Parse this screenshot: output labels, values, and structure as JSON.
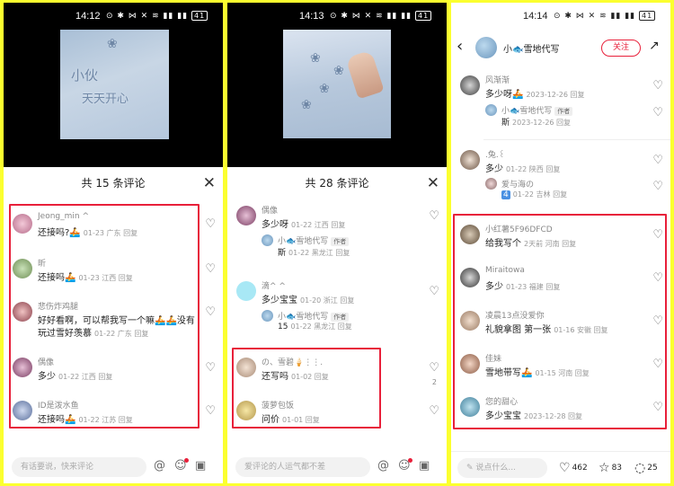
{
  "status": {
    "p1_time": "14:12",
    "p2_time": "14:13",
    "p3_time": "14:14",
    "icons": "⊙ ✱ ⋈ ✕ ≋ ▮▮ ▮▮",
    "battery": "41"
  },
  "p1": {
    "sheet_title": "共 15 条评论",
    "close": "✕",
    "snow_line1": "小伙",
    "snow_line2": "天天开心",
    "comments": [
      {
        "name": "Jeong_min ^",
        "text": "还接吗?🚣",
        "meta": "01-23 广东 回复"
      },
      {
        "name": "昕",
        "text": "还接吗🚣",
        "meta": "01-23 江西 回复"
      },
      {
        "name": "悲伤炸鸡腿",
        "text": "好好看啊，可以帮我写一个嘛🚣🚣没有",
        "text2": "玩过雪好羡慕",
        "meta": "01-22 广东 回复"
      },
      {
        "name": "偶像",
        "text": "多少",
        "meta": "01-22 江西 回复"
      },
      {
        "name": "ID是泼水鱼",
        "text": "还接吗🚣",
        "meta": "01-22 江苏 回复"
      }
    ],
    "input_placeholder": "有话要说，快来评论"
  },
  "p2": {
    "sheet_title": "共 28 条评论",
    "close": "✕",
    "comments": [
      {
        "name": "偶像",
        "text": "多少呀",
        "meta": "01-22 江西 回复"
      },
      {
        "name": "滴^ ^",
        "text": "多少宝宝",
        "meta": "01-20 浙江 回复"
      },
      {
        "name": "の、雪碧🍦⋮⋮.",
        "text": "还写吗",
        "meta": "01-02 回复",
        "likes": "2"
      },
      {
        "name": "菠萝包饭",
        "text": "问价",
        "meta": "01-01 回复"
      }
    ],
    "replies": [
      {
        "name": "小🐟雪地代写",
        "tag": "作者",
        "text": "斯",
        "meta": "01-22 黑龙江 回复"
      },
      {
        "name": "小🐟雪地代写",
        "tag": "作者",
        "text": "15",
        "meta": "01-22 黑龙江 回复"
      }
    ],
    "input_placeholder": "爱评论的人运气都不差"
  },
  "p3": {
    "account_name": "小🐟雪地代写",
    "follow_label": "关注",
    "comments": [
      {
        "name": "风渐渐",
        "text": "多少呀🚣",
        "meta": "2023-12-26 回复"
      },
      {
        "name": ".兔.꒰",
        "text": "多少",
        "meta": "01-22 陕西 回复"
      },
      {
        "name": "小红薯5F96DFCD",
        "text": "给我写个",
        "meta": "2天前 河南 回复"
      },
      {
        "name": "Miraitowa",
        "text": "多少",
        "meta": "01-23 福建 回复"
      },
      {
        "name": "凌晨13点没爱你",
        "text": "礼貌拿图 第一张",
        "meta": "01-16 安徽 回复"
      },
      {
        "name": "佳妹",
        "text": "雪地带写🚣",
        "meta": "01-15 河南 回复"
      },
      {
        "name": "您的甜心",
        "text": "多少宝宝",
        "meta": "2023-12-28 回复"
      }
    ],
    "replies": [
      {
        "name": "小🐟雪地代写",
        "tag": "作者",
        "text": "斯",
        "meta": "2023-12-26 回复"
      },
      {
        "name": "爱与海の",
        "text": "4",
        "meta": "01-22 吉林 回复"
      }
    ],
    "input_placeholder": "说点什么...",
    "likes": "462",
    "stars": "83",
    "comments_count": "25"
  },
  "colors": {
    "accent": "#e8203a",
    "frame": "#fbff2f"
  }
}
